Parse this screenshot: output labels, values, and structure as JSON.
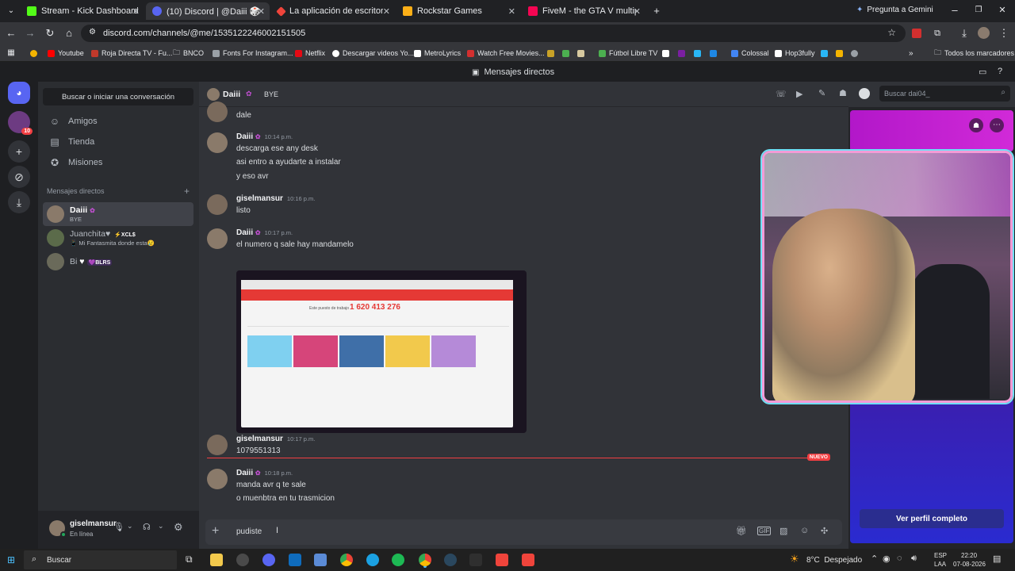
{
  "browser": {
    "tabs": [
      {
        "title": "Stream - Kick Dashboard",
        "favicon_color": "#53fc18"
      },
      {
        "title": "(10) Discord | @Daiii 🎲",
        "favicon_color": "#5865f2"
      },
      {
        "title": "La aplicación de escritorio remo",
        "favicon_color": "#ef443b"
      },
      {
        "title": "Rockstar Games",
        "favicon_color": "#fcaf17"
      },
      {
        "title": "FiveM - the GTA V multiplayer m",
        "favicon_color": "#f40552"
      }
    ],
    "gemini_label": "Pregunta a Gemini",
    "url": "discord.com/channels/@me/1535122246002151505",
    "bookmarks": [
      {
        "label": "",
        "color": "#f4b400"
      },
      {
        "label": "Youtube",
        "color": "#ff0000"
      },
      {
        "label": "Roja Directa TV - Fu...",
        "color": "#c0392b"
      },
      {
        "label": "BNCO",
        "color": "#9aa0a6"
      },
      {
        "label": "Fonts For Instagram...",
        "color": "#9aa0a6"
      },
      {
        "label": "Netflix",
        "color": "#e50914"
      },
      {
        "label": "Descargar videos Yo...",
        "color": "#ffffff"
      },
      {
        "label": "MetroLyrics",
        "color": "#ffffff"
      },
      {
        "label": "Watch Free Movies...",
        "color": "#d32f2f"
      },
      {
        "label": "Fútbol Libre TV",
        "color": "#4caf50"
      },
      {
        "label": "Colossal",
        "color": "#4285f4"
      },
      {
        "label": "Hop3fully",
        "color": "#ffffff"
      }
    ],
    "all_bookmarks": "Todos los marcadores"
  },
  "discord": {
    "window_title": "Mensajes directos",
    "search_button": "Buscar o iniciar una conversación",
    "nav": [
      {
        "label": "Amigos",
        "icon": "friends-icon"
      },
      {
        "label": "Tienda",
        "icon": "shop-icon"
      },
      {
        "label": "Misiones",
        "icon": "quests-icon"
      }
    ],
    "dm_header": "Mensajes directos",
    "guild_badge": "10",
    "dms": [
      {
        "name": "Daiii",
        "sub": "BYE",
        "tag": "",
        "selected": true
      },
      {
        "name": "Juanchita♥",
        "sub": "📱 Mi Fantasmita donde esta😢",
        "tag": "⚡XCL$",
        "selected": false
      },
      {
        "name": "Bi",
        "sub": "",
        "tag": "💜BLRS",
        "selected": false
      }
    ],
    "user": {
      "name": "giselmansur",
      "status": "En línea"
    },
    "chat": {
      "header_name": "Daiii",
      "header_status": "BYE",
      "search_placeholder": "Buscar dai04_",
      "messages": [
        {
          "author": "",
          "time": "",
          "lines": [
            "dale"
          ]
        },
        {
          "author": "Daiii",
          "time": "10:14 p.m.",
          "lines": [
            "descarga ese any desk",
            "asi entro a ayudarte a instalar",
            "y eso avr"
          ]
        },
        {
          "author": "giselmansur",
          "time": "10:16 p.m.",
          "lines": [
            "listo"
          ]
        },
        {
          "author": "Daiii",
          "time": "10:17 p.m.",
          "lines": [
            "el numero q sale hay mandamelo"
          ]
        },
        {
          "author": "giselmansur",
          "time": "10:17 p.m.",
          "lines": [
            "1079551313"
          ]
        },
        {
          "author": "Daiii",
          "time": "10:18 p.m.",
          "lines": [
            "manda avr q te sale",
            "o muenbtra en tu trasmicion"
          ]
        }
      ],
      "attachment": {
        "workspace_label": "Este puesto de trabajo",
        "workspace_id": "1 620 413 276"
      },
      "new_badge": "NUEVO",
      "composer_text": "pudiste"
    },
    "profile_button": "Ver perfil completo"
  },
  "taskbar": {
    "search": "Buscar",
    "weather": "8°C  Despejado",
    "lang_top": "ESP",
    "lang_bottom": "LAA",
    "time": "22:20",
    "date": "07-08-2026"
  }
}
